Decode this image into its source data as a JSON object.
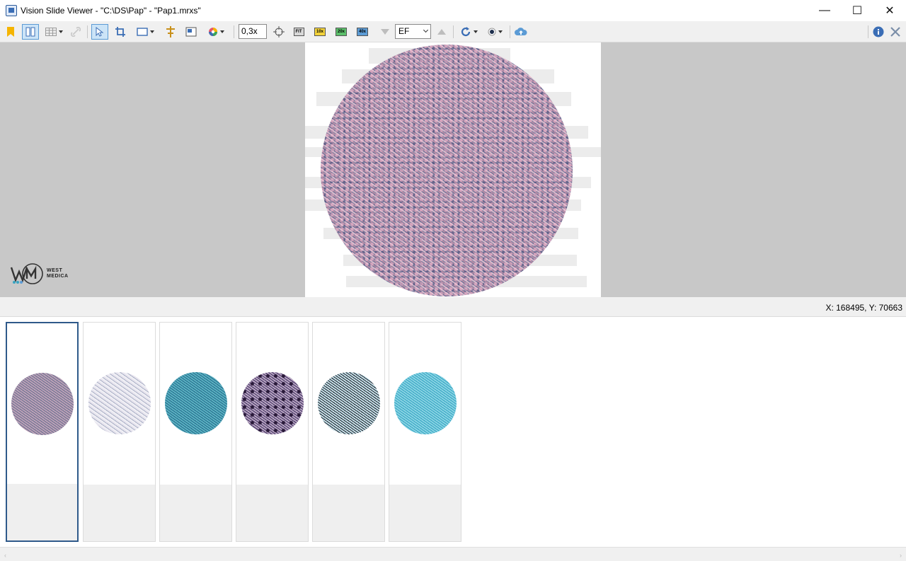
{
  "window": {
    "title": "Vision Slide Viewer - \"C:\\DS\\Pap\" - \"Pap1.mrxs\"",
    "min_glyph": "—",
    "max_glyph": "☐",
    "close_glyph": "✕"
  },
  "toolbar": {
    "zoom_value": "0,3x",
    "fit_label": "FIT",
    "zoom_10x_label": "10x",
    "zoom_20x_label": "20x",
    "zoom_40x_label": "40x",
    "filter_value": "EF",
    "info_glyph": "i"
  },
  "logo": {
    "line1": "WEST",
    "line2": "MEDICA"
  },
  "status": {
    "coords": "X: 168495, Y: 70663"
  },
  "thumbnails": [
    {
      "selected": true
    },
    {
      "selected": false
    },
    {
      "selected": false
    },
    {
      "selected": false
    },
    {
      "selected": false
    },
    {
      "selected": false
    }
  ],
  "scroll": {
    "left_arrow": "‹",
    "right_arrow": "›"
  },
  "colors": {
    "accent": "#5b9bd5",
    "selected_border": "#2f5a8a"
  }
}
